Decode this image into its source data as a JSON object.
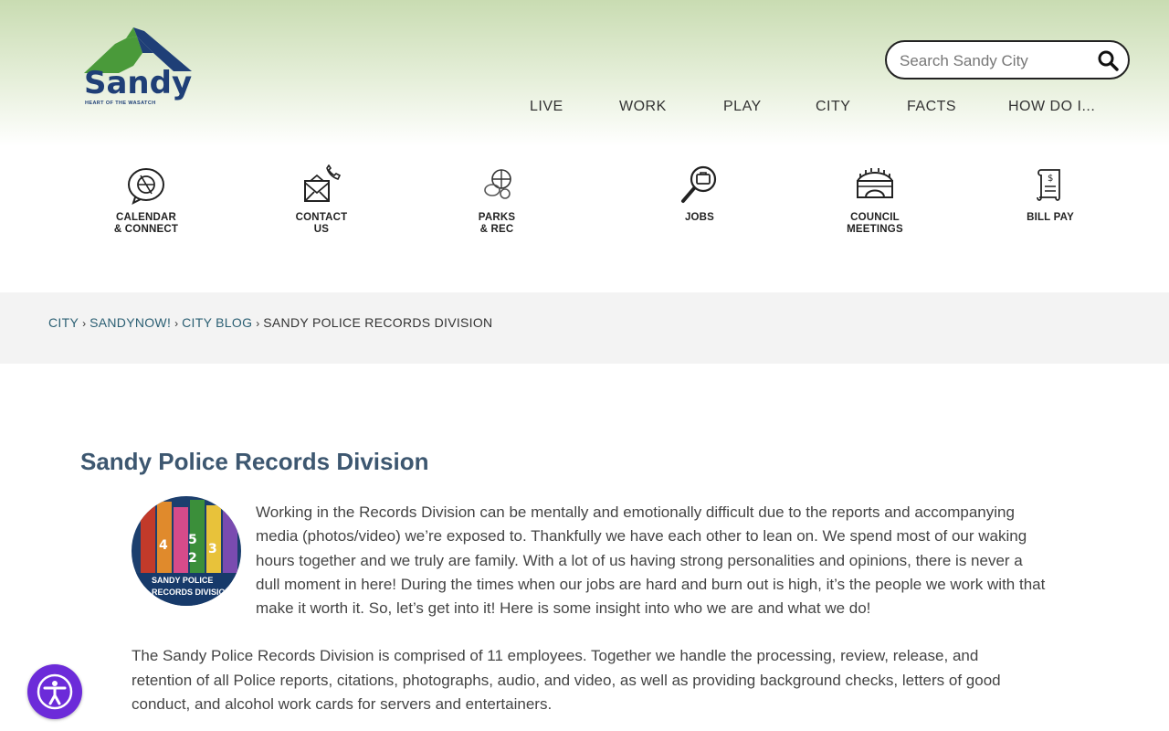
{
  "header": {
    "logo_text": "Sandy",
    "logo_tagline": "HEART OF THE WASATCH",
    "search_placeholder": "Search Sandy City"
  },
  "main_nav": [
    "LIVE",
    "WORK",
    "PLAY",
    "CITY",
    "FACTS",
    "HOW DO I..."
  ],
  "quick_links": [
    {
      "label": "CALENDAR\n& CONNECT",
      "icon": "calendar-connect-icon"
    },
    {
      "label": "CONTACT\nUS",
      "icon": "contact-envelope-icon"
    },
    {
      "label": "PARKS\n& REC",
      "icon": "sports-balls-icon"
    },
    {
      "label": "JOBS",
      "icon": "magnifier-briefcase-icon"
    },
    {
      "label": "COUNCIL\nMEETINGS",
      "icon": "council-building-icon"
    },
    {
      "label": "BILL PAY",
      "icon": "bill-scroll-icon"
    }
  ],
  "breadcrumb": {
    "links": [
      "CITY",
      "SANDYNOW!",
      "CITY BLOG"
    ],
    "separator": "›",
    "current": "SANDY POLICE RECORDS DIVISION"
  },
  "article": {
    "title": "Sandy Police Records Division",
    "image_caption": "SANDY POLICE\nRECORDS DIVISION",
    "paragraph_1": "Working in the Records Division can be mentally and emotionally difficult due to the reports and accompanying media (photos/video) we’re exposed to. Thankfully we have each other to lean on. We spend most of our waking hours together and we truly are family. With a lot of us having strong personalities and opinions, there is never a dull moment in here! During the times when our jobs are hard and burn out is high, it’s the people we work with that make it worth it. So, let’s get into it! Here is some insight into who we are and what we do!",
    "paragraph_2": "The Sandy Police Records Division is comprised of 11 employees. Together we handle the processing, review, release, and retention of all Police reports, citations, photographs, audio, and video, as well as providing background checks, letters of good conduct, and alcohol work cards for servers and entertainers."
  },
  "colors": {
    "logo_green": "#4a9a3a",
    "logo_navy": "#1f3f77",
    "title": "#3d5770",
    "breadcrumb_link": "#2b5f73",
    "accessibility_button": "#6c2bd9"
  }
}
